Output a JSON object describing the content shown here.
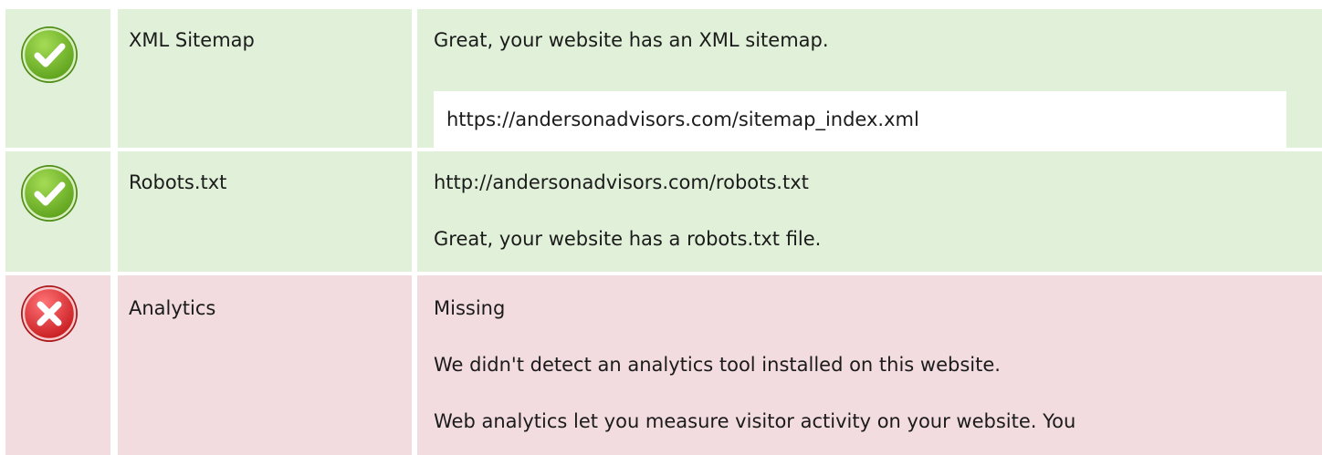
{
  "rows": [
    {
      "status": "pass",
      "icon": "check-circle-icon",
      "name": "XML Sitemap",
      "message": "Great, your website has an XML sitemap.",
      "url": "https://andersonadvisors.com/sitemap_index.xml"
    },
    {
      "status": "pass",
      "icon": "check-circle-icon",
      "name": "Robots.txt",
      "url": "http://andersonadvisors.com/robots.txt",
      "message": "Great, your website has a robots.txt file."
    },
    {
      "status": "fail",
      "icon": "cross-circle-icon",
      "name": "Analytics",
      "value": "Missing",
      "message": "We didn't detect an analytics tool installed on this website.",
      "detail": "Web analytics let you measure visitor activity on your website. You"
    }
  ],
  "colors": {
    "pass_background": "#e1f0d9",
    "fail_background": "#f2dcdf",
    "pass_icon": "#7cbf2a",
    "fail_icon": "#e0393c"
  }
}
